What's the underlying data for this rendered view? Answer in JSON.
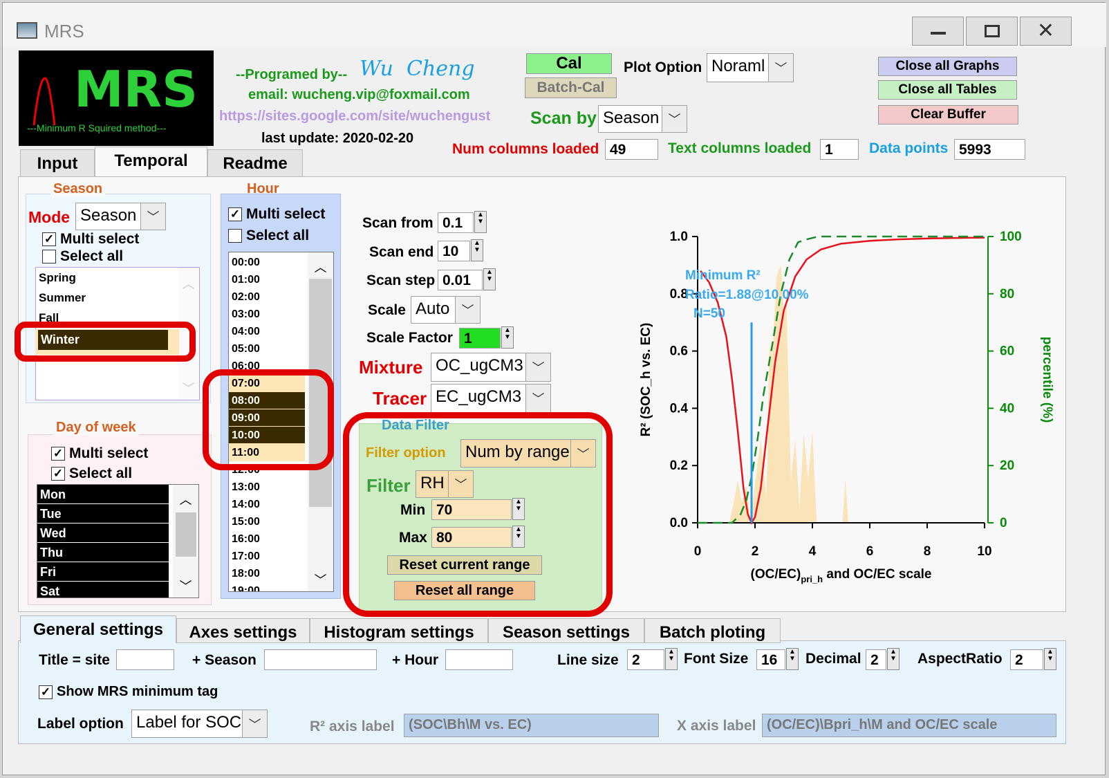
{
  "window": {
    "title": "MRS"
  },
  "logo": {
    "text": "MRS",
    "subtitle": "---Minimum R Squired method---"
  },
  "credits": {
    "programmed_by": "--Programed by--",
    "author": "Wu  Cheng",
    "email": "email: wucheng.vip@foxmail.com",
    "url": "https://sites.google.com/site/wuchengust",
    "last_update": "last update: 2020-02-20"
  },
  "toolbar": {
    "cal": "Cal",
    "batch_cal": "Batch-Cal",
    "plot_option_label": "Plot Option",
    "plot_option_value": "Noraml",
    "scan_by_label": "Scan by",
    "scan_by_value": "Season",
    "close_graphs": "Close all Graphs",
    "close_tables": "Close all Tables",
    "clear_buffer": "Clear Buffer"
  },
  "stats": {
    "num_cols_label": "Num columns loaded",
    "num_cols": "49",
    "text_cols_label": "Text columns loaded",
    "text_cols": "1",
    "data_points_label": "Data points",
    "data_points": "5993"
  },
  "tabs": [
    "Input",
    "Temporal",
    "Readme"
  ],
  "season": {
    "title": "Season",
    "mode_label": "Mode",
    "mode_value": "Season",
    "multi_select": "Multi select",
    "select_all": "Select all",
    "items": [
      "Spring",
      "Summer",
      "Fall",
      "Winter"
    ]
  },
  "hour": {
    "title": "Hour",
    "multi_select": "Multi select",
    "select_all": "Select all",
    "items": [
      "00:00",
      "01:00",
      "02:00",
      "03:00",
      "04:00",
      "05:00",
      "06:00",
      "07:00",
      "08:00",
      "09:00",
      "10:00",
      "11:00",
      "12:00",
      "13:00",
      "14:00",
      "15:00",
      "16:00",
      "17:00",
      "18:00",
      "19:00"
    ]
  },
  "dow": {
    "title": "Day of week",
    "multi_select": "Multi select",
    "select_all": "Select all",
    "items": [
      "Mon",
      "Tue",
      "Wed",
      "Thu",
      "Fri",
      "Sat"
    ]
  },
  "scan": {
    "from_label": "Scan from",
    "from": "0.1",
    "end_label": "Scan end",
    "end": "10",
    "step_label": "Scan step",
    "step": "0.01",
    "scale_label": "Scale",
    "scale": "Auto",
    "factor_label": "Scale Factor",
    "factor": "1",
    "mixture_label": "Mixture",
    "mixture": "OC_ugCM3",
    "tracer_label": "Tracer",
    "tracer": "EC_ugCM3"
  },
  "filter": {
    "title": "Data Filter",
    "option_label": "Filter option",
    "option": "Num by range",
    "filter_label": "Filter",
    "filter": "RH",
    "min_label": "Min",
    "min": "70",
    "max_label": "Max",
    "max": "80",
    "reset_current": "Reset current range",
    "reset_all": "Reset all range"
  },
  "chart_data": {
    "type": "line",
    "title": "",
    "xlabel_main": "(OC/EC)",
    "xlabel_sub": "pri_h",
    "xlabel_rest": " and OC/EC scale",
    "ylabel": "R² (SOC_h vs. EC)",
    "y2label": "percentile (%)",
    "xlim": [
      0,
      10
    ],
    "ylim": [
      0,
      1
    ],
    "y2lim": [
      0,
      100
    ],
    "xticks": [
      "0",
      "2",
      "4",
      "6",
      "8",
      "10"
    ],
    "yticks": [
      "0.0",
      "0.2",
      "0.4",
      "0.6",
      "0.8",
      "1.0"
    ],
    "y2ticks": [
      "0",
      "20",
      "40",
      "60",
      "80",
      "100"
    ],
    "annotation": [
      "Minimum R²",
      "Ratio=1.88@10.00%",
      "N=50"
    ],
    "min_line_x": 1.88,
    "series": [
      {
        "values_x": [
          0.1,
          0.4,
          0.7,
          1.0,
          1.2,
          1.4,
          1.6,
          1.75,
          1.88,
          2.0,
          2.2,
          2.4,
          2.7,
          3.0,
          3.4,
          3.8,
          4.3,
          5,
          6,
          7,
          8,
          9,
          10
        ],
        "values_y": [
          0.88,
          0.84,
          0.77,
          0.65,
          0.5,
          0.32,
          0.12,
          0.03,
          0.0,
          0.02,
          0.12,
          0.3,
          0.56,
          0.74,
          0.86,
          0.92,
          0.955,
          0.975,
          0.985,
          0.99,
          0.993,
          0.995,
          0.996
        ]
      },
      {
        "values_x": [
          0,
          1.2,
          1.5,
          1.7,
          1.9,
          2.1,
          2.3,
          2.6,
          2.9,
          3.2,
          3.5,
          3.8,
          4.2,
          5,
          6,
          8,
          10
        ],
        "values_y": [
          0,
          0,
          3,
          8,
          17,
          30,
          45,
          62,
          80,
          92,
          98,
          99,
          100,
          100,
          100,
          100,
          100
        ]
      },
      {
        "values_x": [
          1.1,
          1.3,
          1.4,
          1.55,
          1.7,
          1.85,
          2.0,
          2.2,
          2.4,
          2.5,
          2.6,
          2.75,
          2.9,
          3.0,
          3.1,
          3.25,
          3.4,
          3.55,
          3.7,
          3.85,
          4.0,
          4.15,
          5.05,
          5.15,
          5.25
        ],
        "values_y": [
          0,
          0.09,
          0.15,
          0.07,
          0.13,
          0.01,
          0.14,
          0.29,
          0.08,
          0.62,
          0.58,
          0.86,
          0.9,
          0.73,
          0.76,
          0.15,
          0.29,
          0.05,
          0.31,
          0.15,
          0.32,
          0,
          0,
          0.15,
          0
        ]
      }
    ]
  },
  "bottom_tabs": [
    "General settings",
    "Axes settings",
    "Histogram settings",
    "Season settings",
    "Batch ploting"
  ],
  "settings": {
    "title_label": "Title = site",
    "season_label": "+ Season",
    "hour_label": "+ Hour",
    "line_size_label": "Line size",
    "line_size": "2",
    "font_size_label": "Font Size",
    "font_size": "16",
    "decimal_label": "Decimal",
    "decimal": "2",
    "aspect_label": "AspectRatio",
    "aspect": "2",
    "show_tag": "Show MRS minimum tag",
    "label_option_label": "Label option",
    "label_option": "Label for SOC",
    "r2_label": "R² axis label",
    "r2_value": "(SOC\\Bh\\M vs. EC)",
    "x_label": "X axis label",
    "x_value": "(OC/EC)\\Bpri_h\\M and OC/EC scale"
  }
}
